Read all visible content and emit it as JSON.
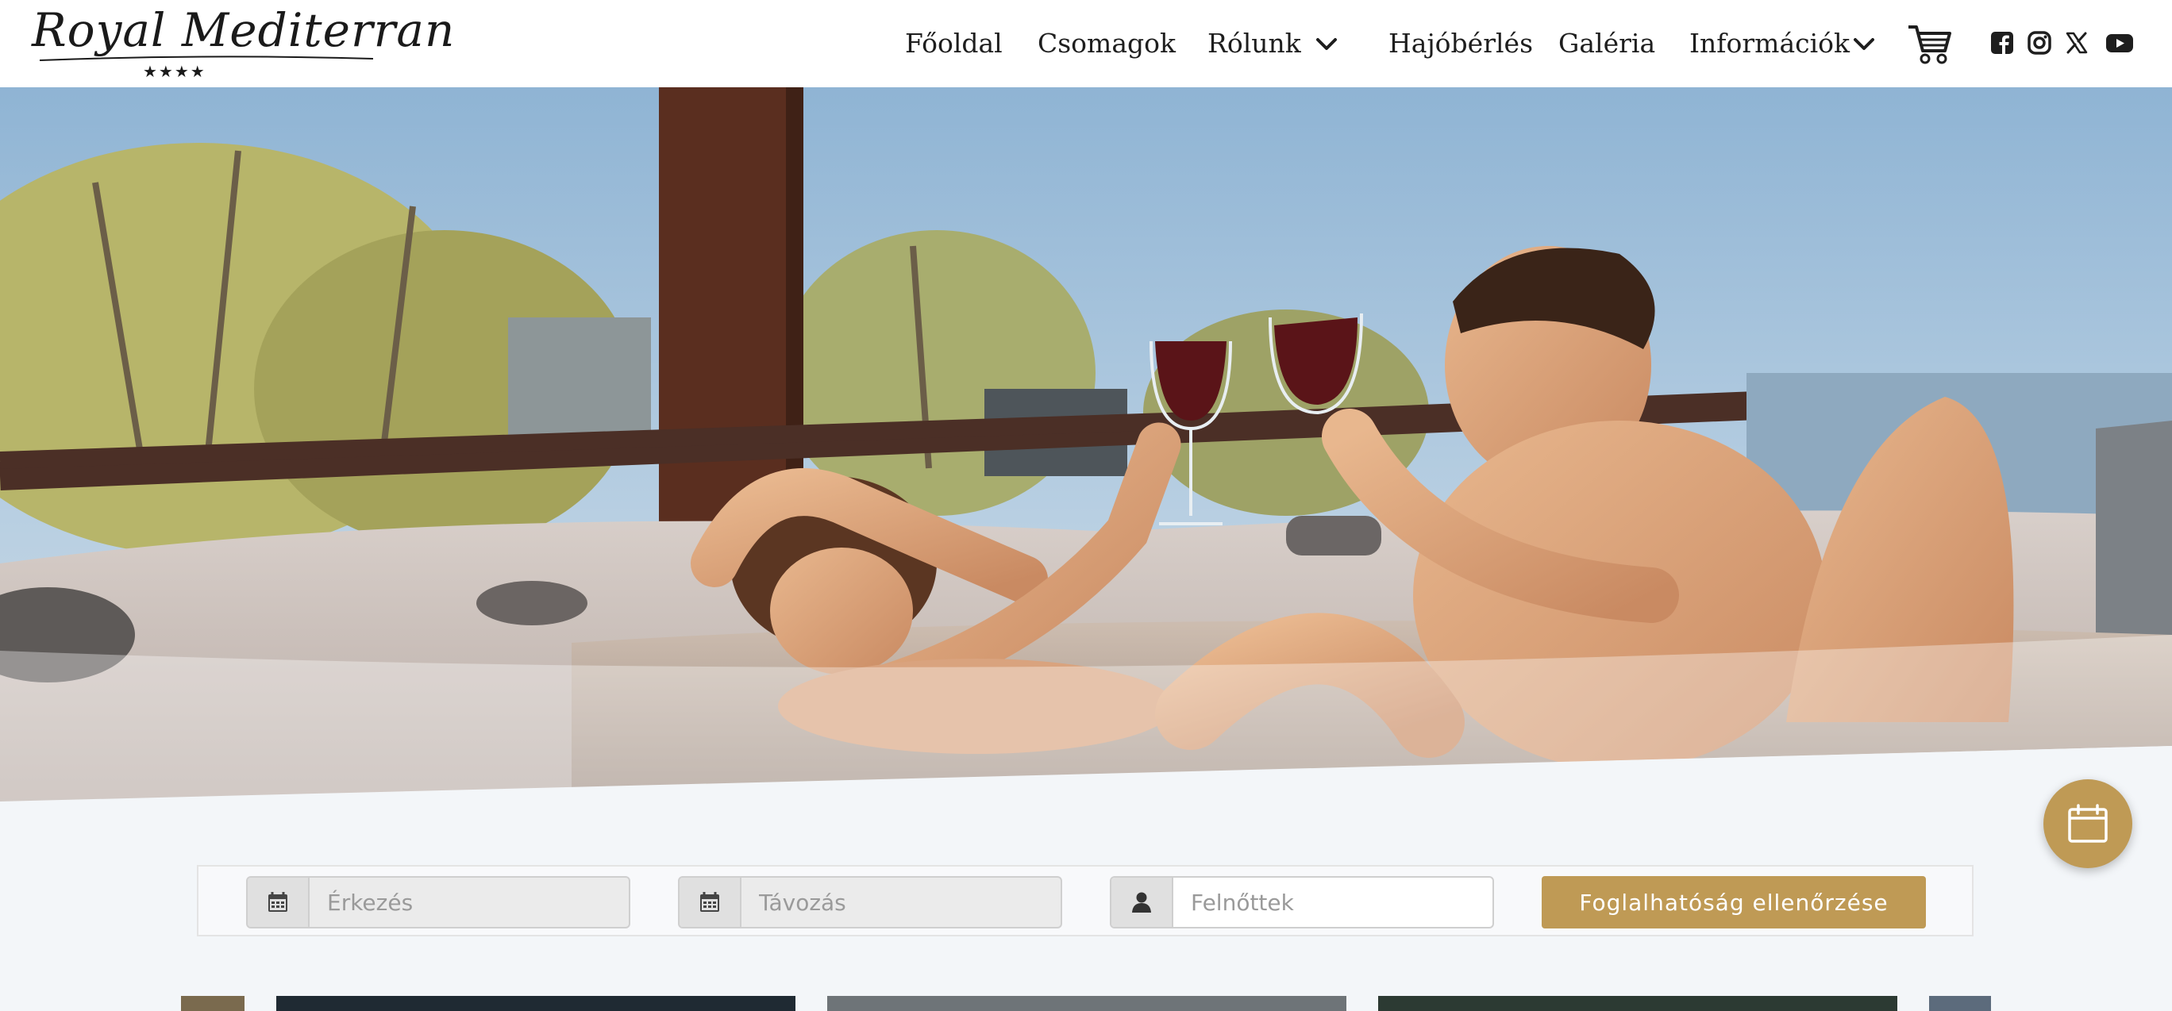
{
  "brand": {
    "logo_text": "Royal Mediterran",
    "stars": "★★★★"
  },
  "nav": {
    "items": [
      {
        "label": "Főoldal"
      },
      {
        "label": "Csomagok"
      },
      {
        "label": "Rólunk",
        "has_dropdown": true
      },
      {
        "label": "Hajóbérlés"
      },
      {
        "label": "Galéria"
      },
      {
        "label": "Információk",
        "has_dropdown": true
      }
    ],
    "cart_icon": "cart-icon",
    "social": [
      "facebook-icon",
      "instagram-icon",
      "x-icon",
      "youtube-icon"
    ]
  },
  "booking": {
    "arrival_placeholder": "Érkezés",
    "departure_placeholder": "Távozás",
    "adults_placeholder": "Felnőttek",
    "check_button": "Foglalhatóság ellenőrzése"
  },
  "colors": {
    "accent": "#bf9a55",
    "text": "#1e1e1e"
  }
}
